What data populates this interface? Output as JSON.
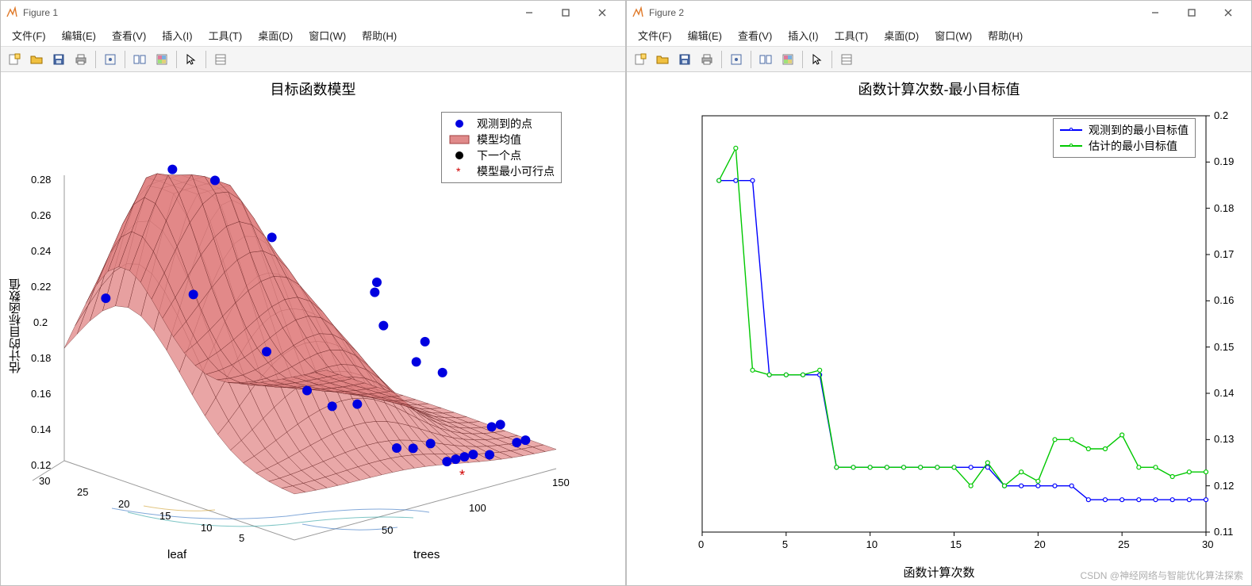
{
  "windows": [
    {
      "title": "Figure 1"
    },
    {
      "title": "Figure 2"
    }
  ],
  "menus": [
    "文件(F)",
    "编辑(E)",
    "查看(V)",
    "插入(I)",
    "工具(T)",
    "桌面(D)",
    "窗口(W)",
    "帮助(H)"
  ],
  "toolbar_icons": [
    "new-figure-icon",
    "open-icon",
    "save-icon",
    "print-icon",
    "sep",
    "datacursor-icon",
    "sep",
    "link-icon",
    "colorbar-icon",
    "sep",
    "pointer-icon",
    "sep",
    "brush-icon"
  ],
  "toolbar_icons_fig1": [
    "new-figure-icon",
    "open-icon",
    "save-icon",
    "print-icon",
    "sep",
    "datacursor-icon",
    "sep",
    "link-icon",
    "colorbar-icon",
    "sep",
    "pointer-icon",
    "sep",
    "brush-icon"
  ],
  "chart_data": [
    {
      "figure": 1,
      "type": "surface3d_with_scatter",
      "title": "目标函数模型",
      "xlabel": "trees",
      "ylabel": "leaf",
      "zlabel": "估计的目标函数值",
      "x_range": [
        0,
        150
      ],
      "y_range": [
        0,
        30
      ],
      "z_range": [
        0.12,
        0.28
      ],
      "x_ticks": [
        50,
        100,
        150
      ],
      "y_ticks": [
        5,
        10,
        15,
        20,
        25,
        30
      ],
      "z_ticks": [
        0.12,
        0.14,
        0.16,
        0.18,
        0.2,
        0.22,
        0.24,
        0.26,
        0.28
      ],
      "legend": [
        {
          "label": "观测到的点",
          "marker": "blue-dot"
        },
        {
          "label": "模型均值",
          "marker": "red-surface"
        },
        {
          "label": "下一个点",
          "marker": "black-dot"
        },
        {
          "label": "模型最小可行点",
          "marker": "red-star"
        }
      ],
      "observed_points_approx": [
        {
          "trees": 15,
          "leaf": 28,
          "z": 0.21
        },
        {
          "trees": 40,
          "leaf": 25,
          "z": 0.28
        },
        {
          "trees": 60,
          "leaf": 24,
          "z": 0.27
        },
        {
          "trees": 30,
          "leaf": 20,
          "z": 0.22
        },
        {
          "trees": 75,
          "leaf": 20,
          "z": 0.24
        },
        {
          "trees": 50,
          "leaf": 15,
          "z": 0.19
        },
        {
          "trees": 60,
          "leaf": 12,
          "z": 0.17
        },
        {
          "trees": 70,
          "leaf": 11,
          "z": 0.16
        },
        {
          "trees": 80,
          "leaf": 10,
          "z": 0.16
        },
        {
          "trees": 90,
          "leaf": 10,
          "z": 0.22
        },
        {
          "trees": 95,
          "leaf": 10,
          "z": 0.2
        },
        {
          "trees": 100,
          "leaf": 12,
          "z": 0.22
        },
        {
          "trees": 105,
          "leaf": 8,
          "z": 0.18
        },
        {
          "trees": 110,
          "leaf": 8,
          "z": 0.19
        },
        {
          "trees": 120,
          "leaf": 8,
          "z": 0.17
        },
        {
          "trees": 85,
          "leaf": 6,
          "z": 0.14
        },
        {
          "trees": 90,
          "leaf": 5,
          "z": 0.14
        },
        {
          "trees": 100,
          "leaf": 5,
          "z": 0.14
        },
        {
          "trees": 105,
          "leaf": 4,
          "z": 0.13
        },
        {
          "trees": 110,
          "leaf": 4,
          "z": 0.13
        },
        {
          "trees": 115,
          "leaf": 4,
          "z": 0.13
        },
        {
          "trees": 120,
          "leaf": 4,
          "z": 0.13
        },
        {
          "trees": 125,
          "leaf": 3,
          "z": 0.13
        },
        {
          "trees": 135,
          "leaf": 5,
          "z": 0.14
        },
        {
          "trees": 140,
          "leaf": 5,
          "z": 0.14
        },
        {
          "trees": 145,
          "leaf": 4,
          "z": 0.13
        },
        {
          "trees": 150,
          "leaf": 4,
          "z": 0.13
        }
      ]
    },
    {
      "figure": 2,
      "type": "line",
      "title": "函数计算次数-最小目标值",
      "xlabel": "函数计算次数",
      "ylabel": "",
      "x_range": [
        0,
        30
      ],
      "y_range": [
        0.11,
        0.2
      ],
      "x_ticks": [
        0,
        5,
        10,
        15,
        20,
        25,
        30
      ],
      "y_ticks": [
        0.11,
        0.12,
        0.13,
        0.14,
        0.15,
        0.16,
        0.17,
        0.18,
        0.19,
        0.2
      ],
      "x": [
        1,
        2,
        3,
        4,
        5,
        6,
        7,
        8,
        9,
        10,
        11,
        12,
        13,
        14,
        15,
        16,
        17,
        18,
        19,
        20,
        21,
        22,
        23,
        24,
        25,
        26,
        27,
        28,
        29,
        30
      ],
      "series": [
        {
          "name": "观测到的最小目标值",
          "color": "#0000ff",
          "values": [
            0.186,
            0.186,
            0.186,
            0.144,
            0.144,
            0.144,
            0.144,
            0.124,
            0.124,
            0.124,
            0.124,
            0.124,
            0.124,
            0.124,
            0.124,
            0.124,
            0.124,
            0.12,
            0.12,
            0.12,
            0.12,
            0.12,
            0.117,
            0.117,
            0.117,
            0.117,
            0.117,
            0.117,
            0.117,
            0.117
          ]
        },
        {
          "name": "估计的最小目标值",
          "color": "#00c800",
          "values": [
            0.186,
            0.193,
            0.145,
            0.144,
            0.144,
            0.144,
            0.145,
            0.124,
            0.124,
            0.124,
            0.124,
            0.124,
            0.124,
            0.124,
            0.124,
            0.12,
            0.125,
            0.12,
            0.123,
            0.121,
            0.13,
            0.13,
            0.128,
            0.128,
            0.131,
            0.124,
            0.124,
            0.122,
            0.123,
            0.123
          ]
        }
      ],
      "legend_position": "top-right"
    }
  ],
  "watermark": "CSDN @神经网络与智能优化算法探索"
}
